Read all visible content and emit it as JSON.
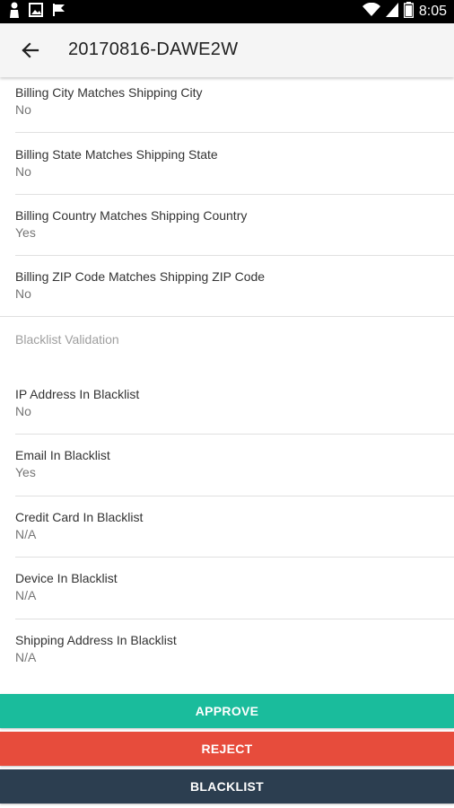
{
  "status_bar": {
    "time": "8:05",
    "left_icons": [
      "person-icon",
      "image-icon",
      "flag-icon"
    ],
    "right_icons": [
      "wifi-icon",
      "signal-icon",
      "battery-icon"
    ]
  },
  "app_bar": {
    "back_icon": "arrow-back-icon",
    "title": "20170816-DAWE2W"
  },
  "address_checks": [
    {
      "label": "Billing City Matches Shipping City",
      "value": "No"
    },
    {
      "label": "Billing State Matches Shipping State",
      "value": "No"
    },
    {
      "label": "Billing Country Matches Shipping Country",
      "value": "Yes"
    },
    {
      "label": "Billing ZIP Code Matches Shipping ZIP Code",
      "value": "No"
    }
  ],
  "blacklist_section": {
    "title": "Blacklist Validation",
    "items": [
      {
        "label": "IP Address In Blacklist",
        "value": "No"
      },
      {
        "label": "Email In Blacklist",
        "value": "Yes"
      },
      {
        "label": "Credit Card In Blacklist",
        "value": "N/A"
      },
      {
        "label": "Device In Blacklist",
        "value": "N/A"
      },
      {
        "label": "Shipping Address In Blacklist",
        "value": "N/A"
      }
    ]
  },
  "actions": {
    "approve": {
      "label": "APPROVE",
      "color": "#1abc9c"
    },
    "reject": {
      "label": "REJECT",
      "color": "#e74c3c"
    },
    "blacklist": {
      "label": "BLACKLIST",
      "color": "#2c3e50"
    }
  }
}
